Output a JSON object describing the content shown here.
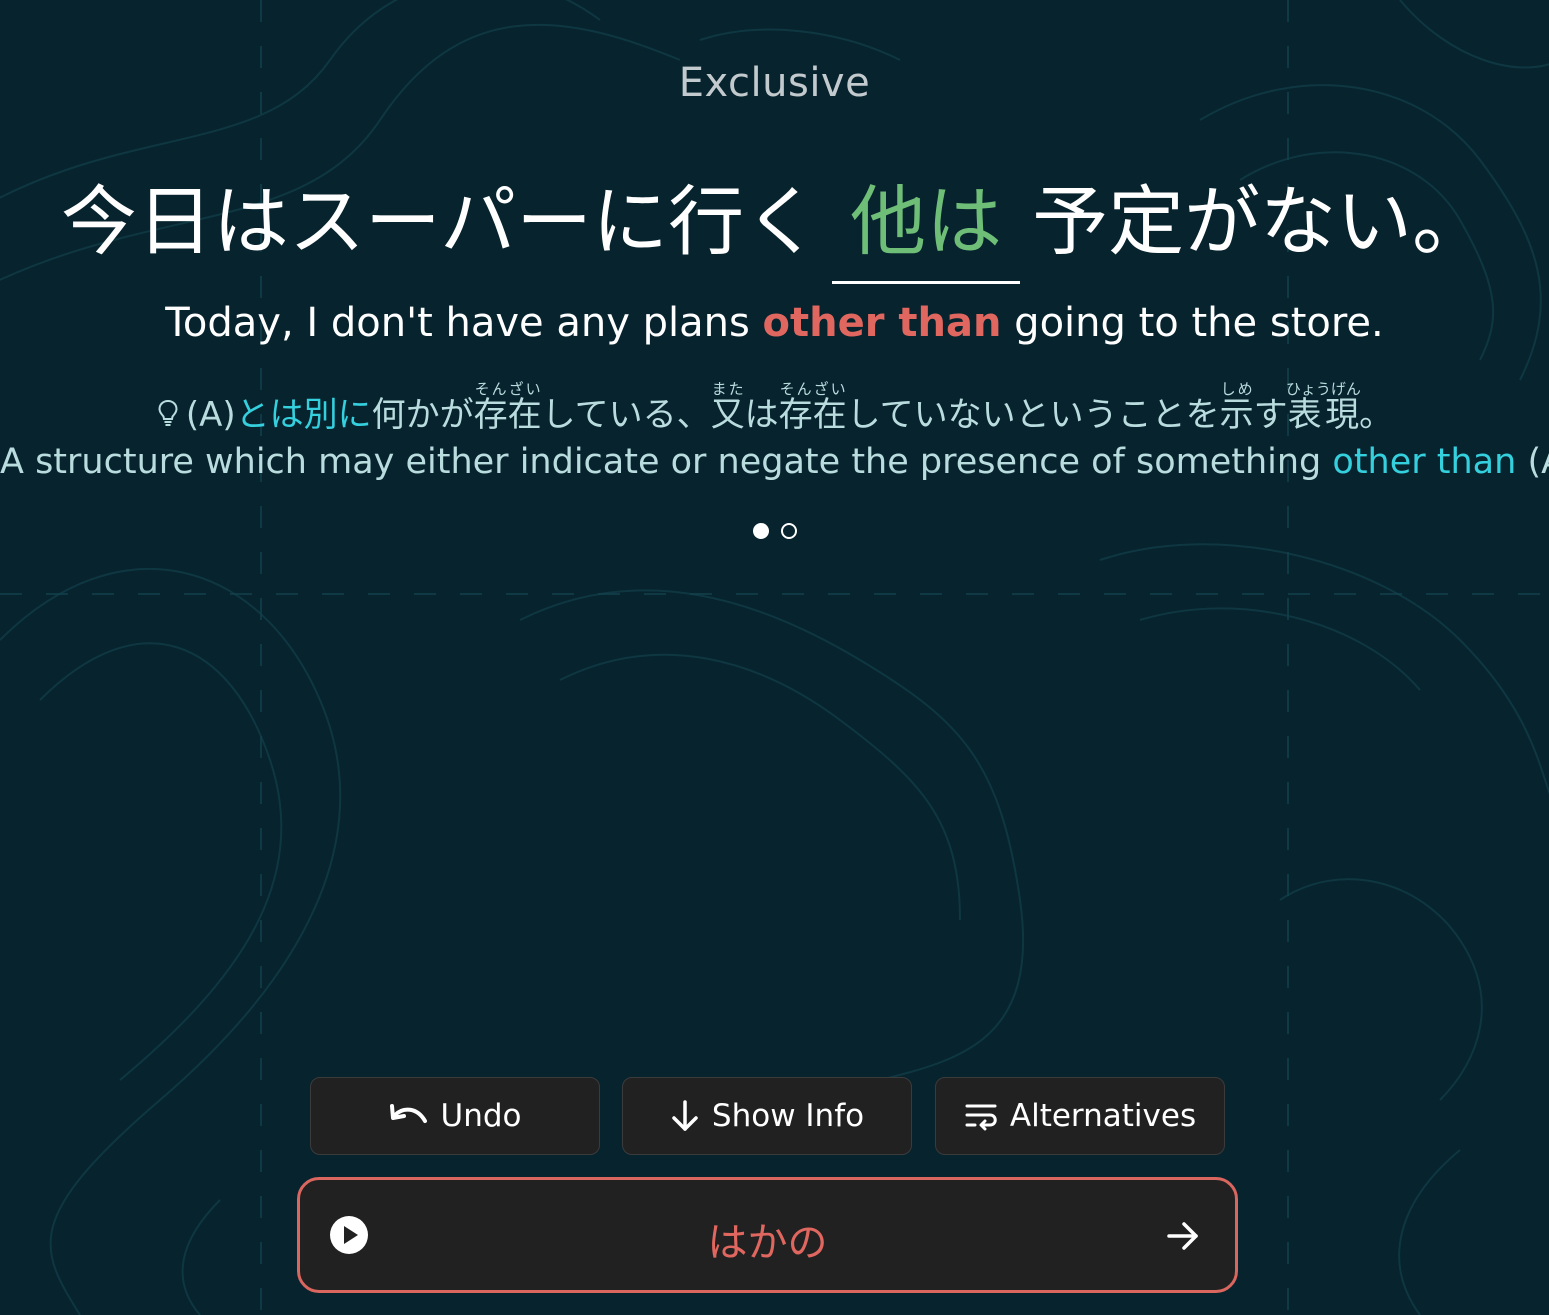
{
  "card": {
    "category": "Exclusive",
    "sentence_jp": {
      "before": "今日はスーパーに行く",
      "blank": "他は",
      "after": "予定がない。"
    },
    "sentence_en": {
      "before": "Today, I don't have any plans ",
      "highlight": "other than",
      "after": " going to the store."
    },
    "meaning_jp": {
      "prefix": "(A)",
      "highlight": "とは別に",
      "part1": "何かが",
      "w1": "存在",
      "w1_ruby": "そんざい",
      "part2": "している、",
      "w2": "又",
      "w2_ruby": "また",
      "part3": "は",
      "w3": "存在",
      "w3_ruby": "そんざい",
      "part4": "していないということを",
      "w4": "示",
      "w4_ruby": "しめ",
      "part5": "す",
      "w5": "表現",
      "w5_ruby": "ひょうげん",
      "suffix": "。"
    },
    "meaning_en": {
      "before": "A structure which may either indicate or negate the presence of something ",
      "highlight": "other than",
      "after": " (A)."
    },
    "pagination": {
      "active": 1,
      "total": 2
    }
  },
  "actions": {
    "undo_label": "Undo",
    "show_info_label": "Show Info",
    "alternatives_label": "Alternatives"
  },
  "answer": {
    "text": "はかの"
  },
  "icons": {
    "undo": "undo-icon",
    "show_info": "arrow-down-icon",
    "alternatives": "wrap-lines-icon",
    "play": "play-icon",
    "next": "arrow-right-icon",
    "hint": "lightbulb-icon"
  },
  "colors": {
    "background": "#07232e",
    "blank_correct": "#6fbe78",
    "highlight_red": "#e0675f",
    "highlight_cyan": "#35d0de",
    "answer_border": "#d9665f",
    "button_bg": "#212121"
  }
}
